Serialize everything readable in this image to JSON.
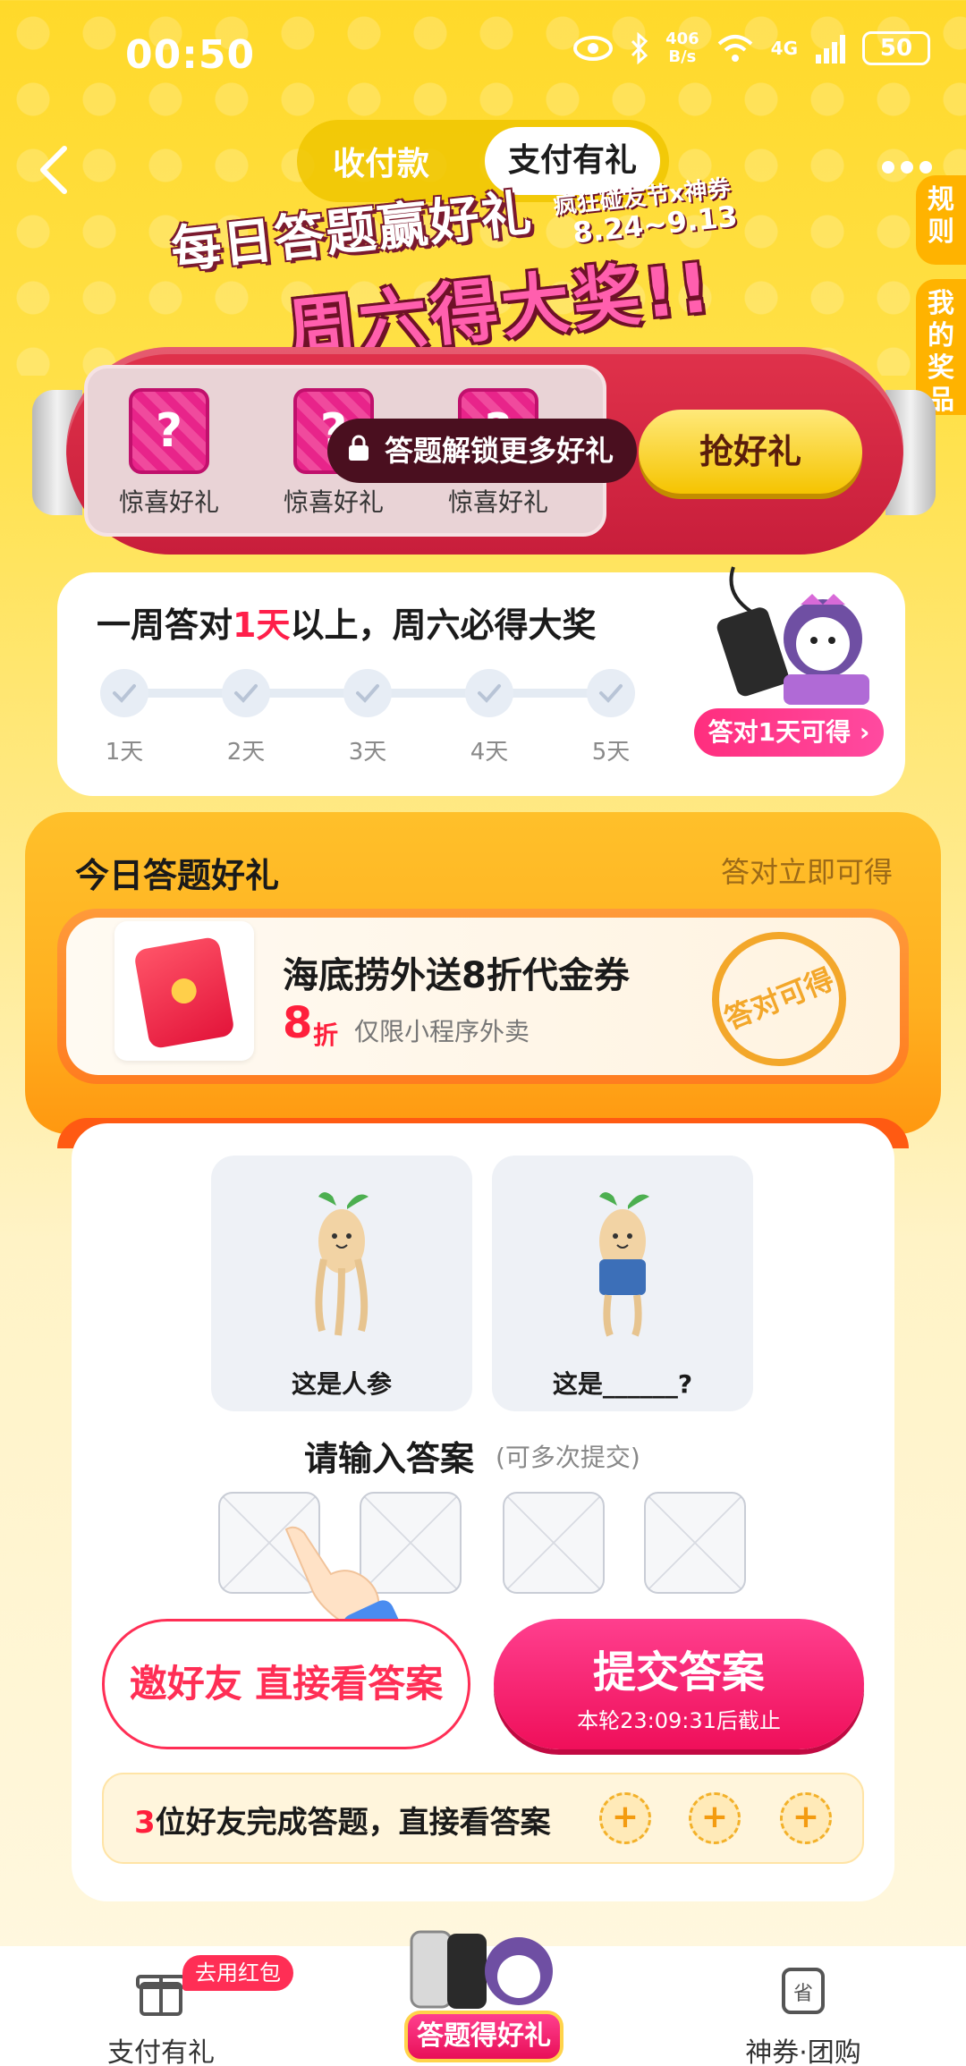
{
  "status": {
    "time": "00:50",
    "speed_value": "406",
    "speed_unit": "B/s",
    "battery": "50",
    "network": "4G"
  },
  "header": {
    "tabs": [
      "收付款",
      "支付有礼"
    ],
    "active_tab": "支付有礼",
    "side_rules": "规则",
    "side_prizes": "我的奖品"
  },
  "banner": {
    "line1": "每日答题赢好礼",
    "line2": "周六得大奖!!",
    "event": "疯狂碰友节x神券",
    "dates": "8.24~9.13"
  },
  "capsule": {
    "gifts": [
      {
        "icon": "?",
        "label": "惊喜好礼"
      },
      {
        "icon": "?",
        "label": "惊喜好礼"
      },
      {
        "icon": "?",
        "label": "惊喜好礼"
      }
    ],
    "lock_text": "答题解锁更多好礼",
    "grab_button": "抢好礼"
  },
  "week": {
    "title_pre": "一周答对",
    "title_hl": "1天",
    "title_post": "以上，周六必得大奖",
    "days": [
      "1天",
      "2天",
      "3天",
      "4天",
      "5天"
    ],
    "prize_pill": "答对1天可得 ›"
  },
  "today": {
    "title": "今日答题好礼",
    "hint": "答对立即可得",
    "coupon_name": "海底捞外送8折代金券",
    "coupon_value": "8",
    "coupon_unit": "折",
    "coupon_desc": "仅限小程序外卖",
    "stamp": "答对可得"
  },
  "question": {
    "left_caption": "这是人参",
    "right_caption": "这是______?",
    "input_title": "请输入答案",
    "input_sub": "(可多次提交)",
    "invite_button": "邀好友 直接看答案",
    "submit_button": "提交答案",
    "submit_deadline": "本轮23:09:31后截止",
    "friend_count": "3",
    "friend_text": "位好友完成答题，直接看答案",
    "plus": [
      "+",
      "+",
      "+"
    ]
  },
  "bottom_nav": {
    "left_label": "支付有礼",
    "left_tag": "去用红包",
    "center_label": "答题得好礼",
    "right_label": "神券·团购"
  },
  "colors": {
    "accent": "#ff2e55",
    "gold": "#ffd92a",
    "deep_red": "#c81e3b"
  }
}
